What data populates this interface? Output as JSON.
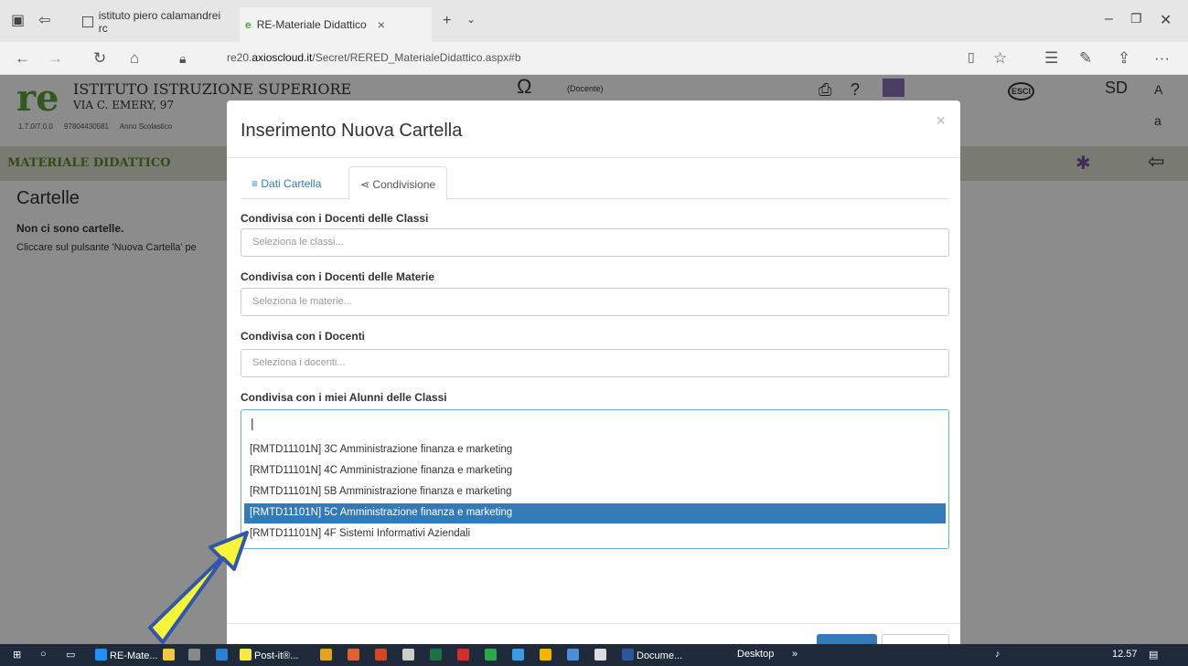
{
  "browser": {
    "tab_inactive": "istituto piero calamandrei rc",
    "tab_active": "RE-Materiale Didattico",
    "close": "×",
    "new_tab": "+",
    "url_prefix": "re20.",
    "url_domain": "axioscloud.it",
    "url_path": "/Secret/RERED_MaterialeDidattico.aspx#b"
  },
  "header": {
    "institute_name": "ISTITUTO ISTRUZIONE SUPERIORE",
    "institute_address": "VIA C. EMERY, 97",
    "version": "1.7.0/7.0.0",
    "code": "97804430581",
    "school_year_label": "Anno Scolastico",
    "role": "(Docente)",
    "esci": "ESCI",
    "sd": "SD"
  },
  "section": {
    "title": "MATERIALE DIDATTICO",
    "heading": "Cartelle",
    "empty_msg": "Non ci sono cartelle.",
    "hint": "Cliccare sul pulsante 'Nuova Cartella' pe"
  },
  "modal": {
    "title": "Inserimento Nuova Cartella",
    "close": "×",
    "tabs": [
      {
        "label": "Dati Cartella"
      },
      {
        "label": "Condivisione"
      }
    ],
    "fields": [
      {
        "label": "Condivisa con i Docenti delle Classi",
        "placeholder": "Seleziona le classi..."
      },
      {
        "label": "Condivisa con i Docenti delle Materie",
        "placeholder": "Seleziona le materie..."
      },
      {
        "label": "Condivisa con i Docenti",
        "placeholder": "Seleziona i docenti..."
      },
      {
        "label": "Condivisa con i miei Alunni delle Classi",
        "placeholder": ""
      }
    ],
    "dropdown_items": [
      "[RMTD11101N] 3C Amministrazione finanza e marketing",
      "[RMTD11101N] 4C Amministrazione finanza e marketing",
      "[RMTD11101N] 5B Amministrazione finanza e marketing",
      "[RMTD11101N] 5C Amministrazione finanza e marketing",
      "[RMTD11101N] 4F Sistemi Informativi Aziendali"
    ],
    "selected_index": 3
  },
  "taskbar": {
    "items": [
      "RE-Mate...",
      "Post-it®...",
      "Docume...",
      "Desktop"
    ],
    "time": "12.57"
  },
  "colors": {
    "accent": "#337ab7",
    "green": "#5b8a2c",
    "arrow": "#f5f53a"
  }
}
